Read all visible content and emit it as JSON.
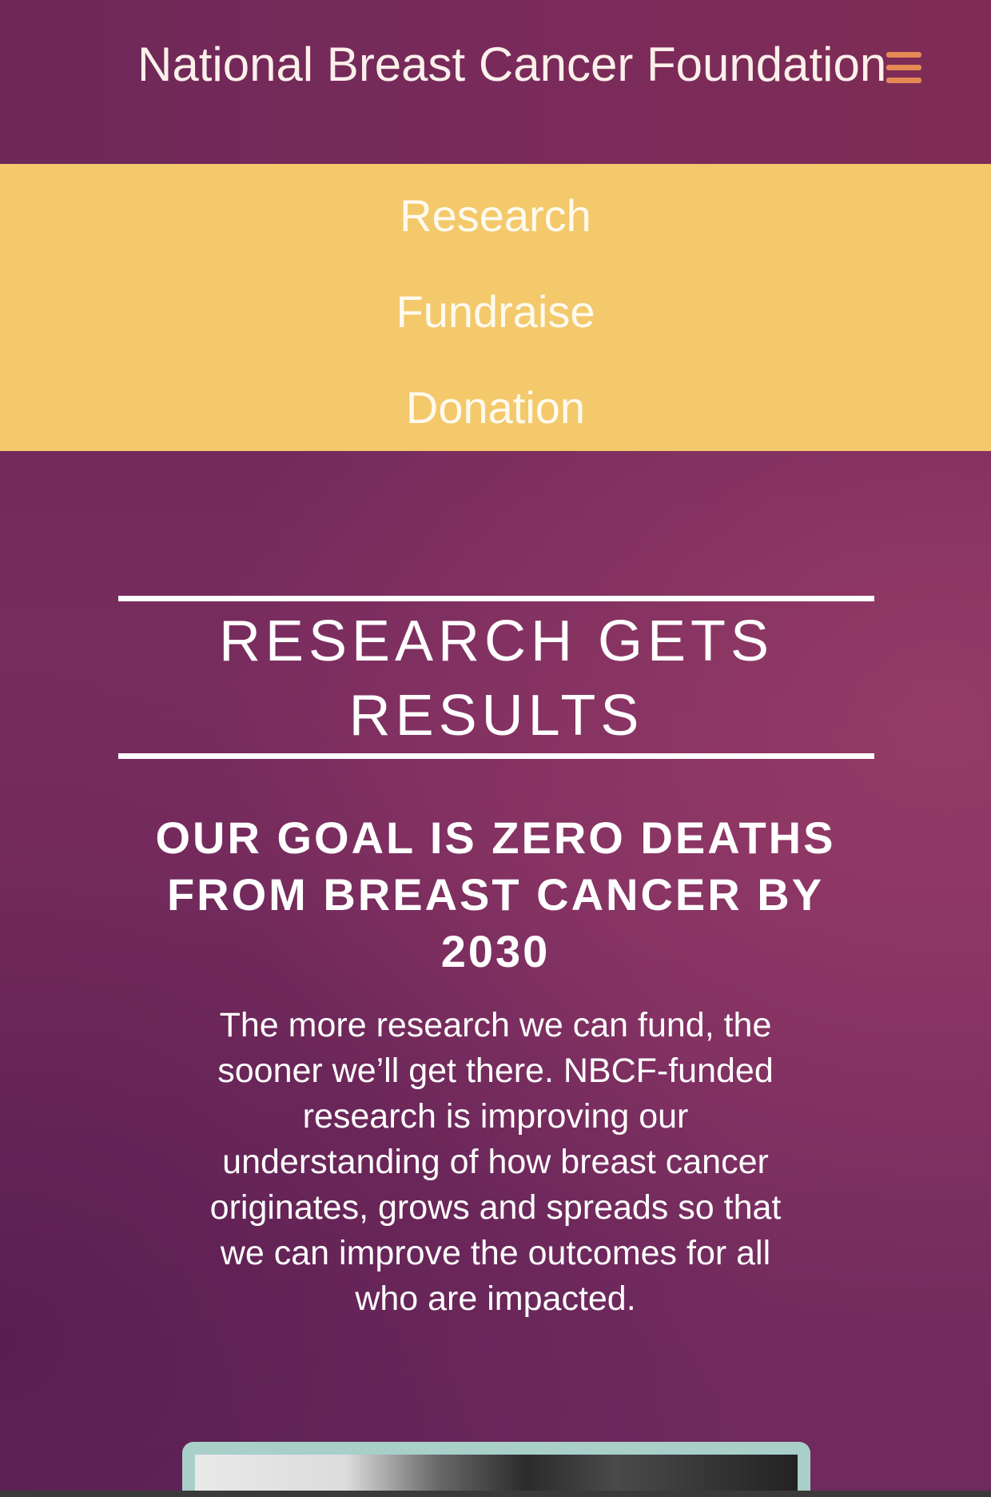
{
  "header": {
    "brand": "National Breast Cancer Foundation",
    "menu_icon": "hamburger-menu-icon",
    "menu_icon_color": "#e58a55"
  },
  "nav": {
    "background": "#f3c96b",
    "items": [
      {
        "label": "Research"
      },
      {
        "label": "Fundraise"
      },
      {
        "label": "Donation"
      }
    ]
  },
  "hero": {
    "headline_line1": "RESEARCH GETS",
    "headline_line2": "RESULTS",
    "goal_line1": "OUR GOAL IS ZERO DEATHS",
    "goal_line2": "FROM BREAST CANCER BY",
    "goal_line3": "2030",
    "body_lines": [
      "The more research we can fund, the",
      "sooner we’ll get there. NBCF-funded",
      "research is improving our",
      "understanding of how breast cancer",
      "originates, grows and spreads so that",
      "we can improve the outcomes for all",
      "who are impacted."
    ]
  }
}
